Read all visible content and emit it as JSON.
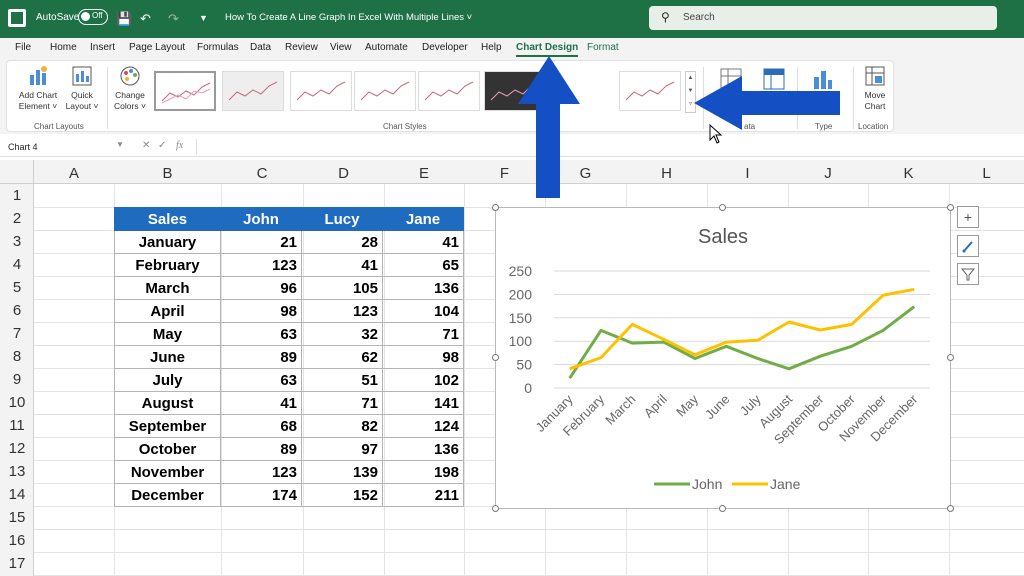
{
  "titlebar": {
    "autosave_label": "AutoSave",
    "autosave_state": "Off",
    "document_title": "How To Create A Line Graph In Excel With Multiple Lines ˅",
    "search_placeholder": "Search"
  },
  "tabs": [
    "File",
    "Home",
    "Insert",
    "Page Layout",
    "Formulas",
    "Data",
    "Review",
    "View",
    "Automate",
    "Developer",
    "Help",
    "Chart Design",
    "Format"
  ],
  "ribbon": {
    "add_chart_element": [
      "Add Chart",
      "Element ˅"
    ],
    "quick_layout": [
      "Quick",
      "Layout ˅"
    ],
    "change_colors": [
      "Change",
      "Colors ˅"
    ],
    "move_chart": [
      "Move",
      "Chart"
    ],
    "groups": {
      "chart_layouts": "Chart Layouts",
      "chart_styles": "Chart Styles",
      "data": "ata",
      "type": "Type",
      "location": "Location"
    },
    "partial_label": "e"
  },
  "formula_bar": {
    "name_box": "Chart 4",
    "fx": "fx"
  },
  "grid": {
    "columns": [
      "A",
      "B",
      "C",
      "D",
      "E",
      "F",
      "G",
      "H",
      "I",
      "J",
      "K",
      "L"
    ],
    "rows": [
      "1",
      "2",
      "3",
      "4",
      "5",
      "6",
      "7",
      "8",
      "9",
      "10",
      "11",
      "12",
      "13",
      "14",
      "15",
      "16",
      "17"
    ]
  },
  "table": {
    "headers": [
      "Sales",
      "John",
      "Lucy",
      "Jane"
    ],
    "rows": [
      [
        "January",
        "21",
        "28",
        "41"
      ],
      [
        "February",
        "123",
        "41",
        "65"
      ],
      [
        "March",
        "96",
        "105",
        "136"
      ],
      [
        "April",
        "98",
        "123",
        "104"
      ],
      [
        "May",
        "63",
        "32",
        "71"
      ],
      [
        "June",
        "89",
        "62",
        "98"
      ],
      [
        "July",
        "63",
        "51",
        "102"
      ],
      [
        "August",
        "41",
        "71",
        "141"
      ],
      [
        "September",
        "68",
        "82",
        "124"
      ],
      [
        "October",
        "89",
        "97",
        "136"
      ],
      [
        "November",
        "123",
        "139",
        "198"
      ],
      [
        "December",
        "174",
        "152",
        "211"
      ]
    ]
  },
  "chart_data": {
    "type": "line",
    "title": "Sales",
    "categories": [
      "January",
      "February",
      "March",
      "April",
      "May",
      "June",
      "July",
      "August",
      "September",
      "October",
      "November",
      "December"
    ],
    "series": [
      {
        "name": "John",
        "color": "#70ad47",
        "values": [
          21,
          123,
          96,
          98,
          63,
          89,
          63,
          41,
          68,
          89,
          123,
          174
        ]
      },
      {
        "name": "Jane",
        "color": "#ffc000",
        "values": [
          41,
          65,
          136,
          104,
          71,
          98,
          102,
          141,
          124,
          136,
          198,
          211
        ]
      }
    ],
    "yticks": [
      0,
      50,
      100,
      150,
      200,
      250
    ],
    "ylim": [
      0,
      250
    ],
    "grid": true,
    "legend": "bottom"
  },
  "colors": {
    "excel_green": "#1e7145",
    "header_blue": "#1f6bc0",
    "arrow_blue": "#1450c4"
  }
}
